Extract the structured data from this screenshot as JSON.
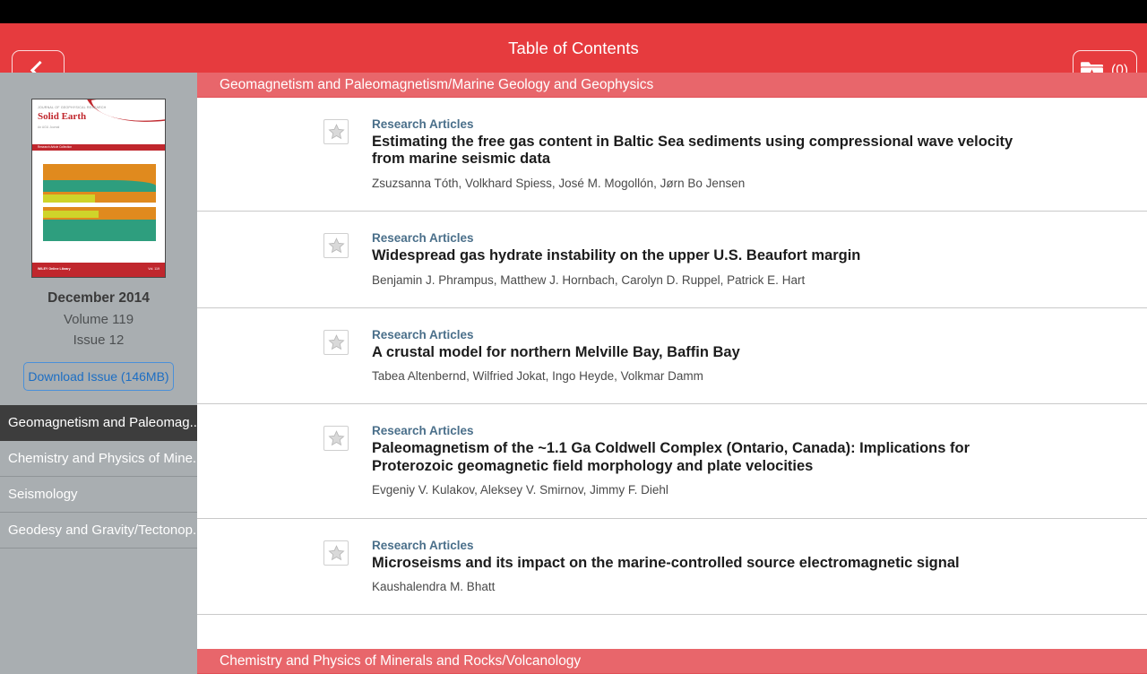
{
  "header": {
    "title": "Table of Contents",
    "back_icon": "chevron-left-icon",
    "favorites_icon": "folder-star-icon",
    "favorites_count": "(0)",
    "background_color": "#e63b3e"
  },
  "sidebar": {
    "cover": {
      "journal_line": "JOURNAL OF GEOPHYSICAL RESEARCH",
      "journal_title": "Solid Earth",
      "journal_subtitle": "An AGU Journal",
      "logo": "JGR",
      "banner_text": "Research Article Collection",
      "footer_left": "WILEY Online Library",
      "footer_right": "Vol. 119"
    },
    "issue_date": "December 2014",
    "volume": "Volume 119",
    "issue": "Issue 12",
    "download_label": "Download Issue (146MB)",
    "nav_items": [
      {
        "label": "Geomagnetism and Paleomag..",
        "selected": true
      },
      {
        "label": "Chemistry and Physics of Mine..",
        "selected": false
      },
      {
        "label": "Seismology",
        "selected": false
      },
      {
        "label": "Geodesy and Gravity/Tectonop..",
        "selected": false
      }
    ],
    "background_color": "#a9aeb1",
    "selected_color": "#3d3d3d"
  },
  "content": {
    "section_header": "Geomagnetism and Paleomagnetism/Marine Geology and Geophysics",
    "section_header_next": "Chemistry and Physics of Minerals and Rocks/Volcanology",
    "section_color": "#e8666b",
    "star_icon": "star-outline-icon",
    "articles": [
      {
        "type": "Research Articles",
        "title": "Estimating the free gas content in Baltic Sea sediments using compressional wave velocity from marine seismic data",
        "authors": "Zsuzsanna Tóth, Volkhard Spiess, José M. Mogollón, Jørn Bo Jensen"
      },
      {
        "type": "Research Articles",
        "title": "Widespread gas hydrate instability on the upper U.S. Beaufort margin",
        "authors": "Benjamin J. Phrampus, Matthew J. Hornbach, Carolyn D. Ruppel, Patrick E. Hart"
      },
      {
        "type": "Research Articles",
        "title": "A crustal model for northern Melville Bay, Baffin Bay",
        "authors": "Tabea Altenbernd, Wilfried Jokat, Ingo Heyde, Volkmar Damm"
      },
      {
        "type": "Research Articles",
        "title": "Paleomagnetism of the ~1.1 Ga Coldwell Complex (Ontario, Canada): Implications for Proterozoic geomagnetic field morphology and plate velocities",
        "authors": "Evgeniy V. Kulakov, Aleksey V. Smirnov, Jimmy F. Diehl"
      },
      {
        "type": "Research Articles",
        "title": "Microseisms and its impact on the marine-controlled source electromagnetic signal",
        "authors": "Kaushalendra M. Bhatt"
      }
    ]
  }
}
